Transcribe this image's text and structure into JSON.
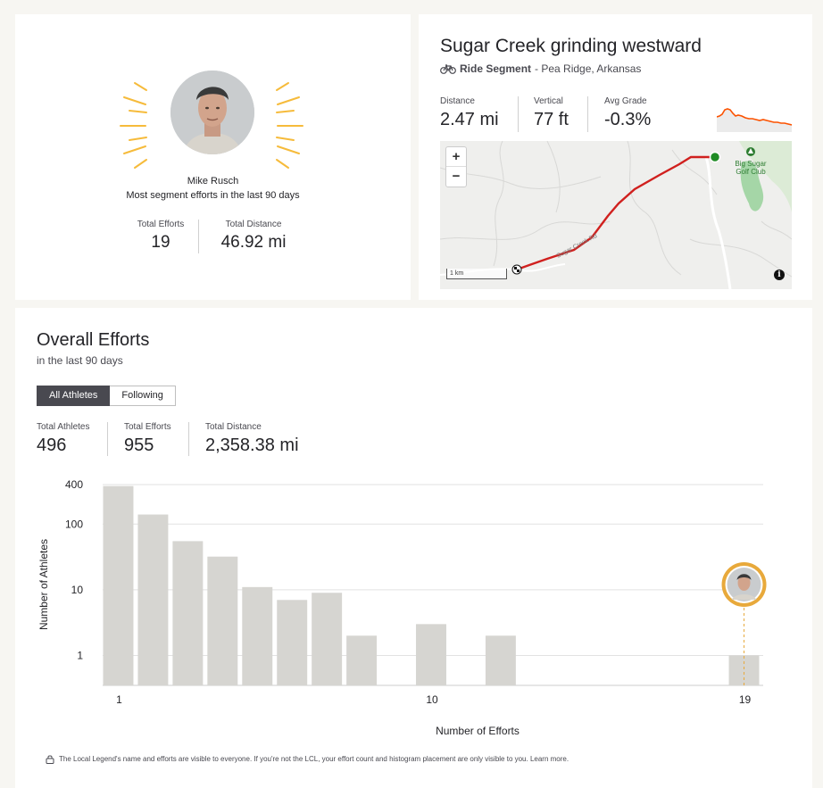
{
  "legend": {
    "name": "Mike Rusch",
    "subtitle": "Most segment efforts in the last 90 days",
    "stats": [
      {
        "label": "Total Efforts",
        "value": "19"
      },
      {
        "label": "Total Distance",
        "value": "46.92 mi"
      }
    ]
  },
  "segment": {
    "title": "Sugar Creek grinding westward",
    "type_icon": "bike-icon",
    "type": "Ride Segment",
    "location": "- Pea Ridge, Arkansas",
    "stats": [
      {
        "label": "Distance",
        "value": "2.47 mi"
      },
      {
        "label": "Vertical",
        "value": "77 ft"
      },
      {
        "label": "Avg Grade",
        "value": "-0.3%"
      }
    ],
    "map": {
      "zoom_in": "+",
      "zoom_out": "−",
      "scale": "1 km",
      "road_label": "Sugar Creek Rd",
      "poi_label_1": "Big Sugar",
      "poi_label_2": "Golf Club",
      "info": "i"
    },
    "colors": {
      "route": "#d0201e",
      "elevation": "#fc5200",
      "start": "#1f8b24"
    }
  },
  "efforts": {
    "title": "Overall Efforts",
    "subtitle": "in the last 90 days",
    "tabs": [
      {
        "label": "All Athletes",
        "active": true
      },
      {
        "label": "Following",
        "active": false
      }
    ],
    "stats": [
      {
        "label": "Total Athletes",
        "value": "496"
      },
      {
        "label": "Total Efforts",
        "value": "955"
      },
      {
        "label": "Total Distance",
        "value": "2,358.38 mi"
      }
    ],
    "footnote": "The Local Legend's name and efforts are visible to everyone. If you're not the LCL, your effort count and histogram placement are only visible to you. Learn more."
  },
  "chart_data": {
    "type": "bar",
    "x": [
      1,
      2,
      3,
      4,
      5,
      6,
      7,
      8,
      10,
      12,
      19
    ],
    "values": [
      380,
      140,
      55,
      32,
      11,
      7,
      9,
      2,
      3,
      2,
      1
    ],
    "xticks": [
      1,
      10,
      19
    ],
    "yticks": [
      1,
      10,
      100,
      400
    ],
    "yscale": "log",
    "xlabel": "Number of Efforts",
    "ylabel": "Number of Athletes",
    "xlim": [
      1,
      19
    ],
    "ylim": [
      0.35,
      400
    ],
    "grid": true,
    "bar_color": "#d6d5d1",
    "highlight_x": 19,
    "highlight_color": "#e8a93b"
  }
}
